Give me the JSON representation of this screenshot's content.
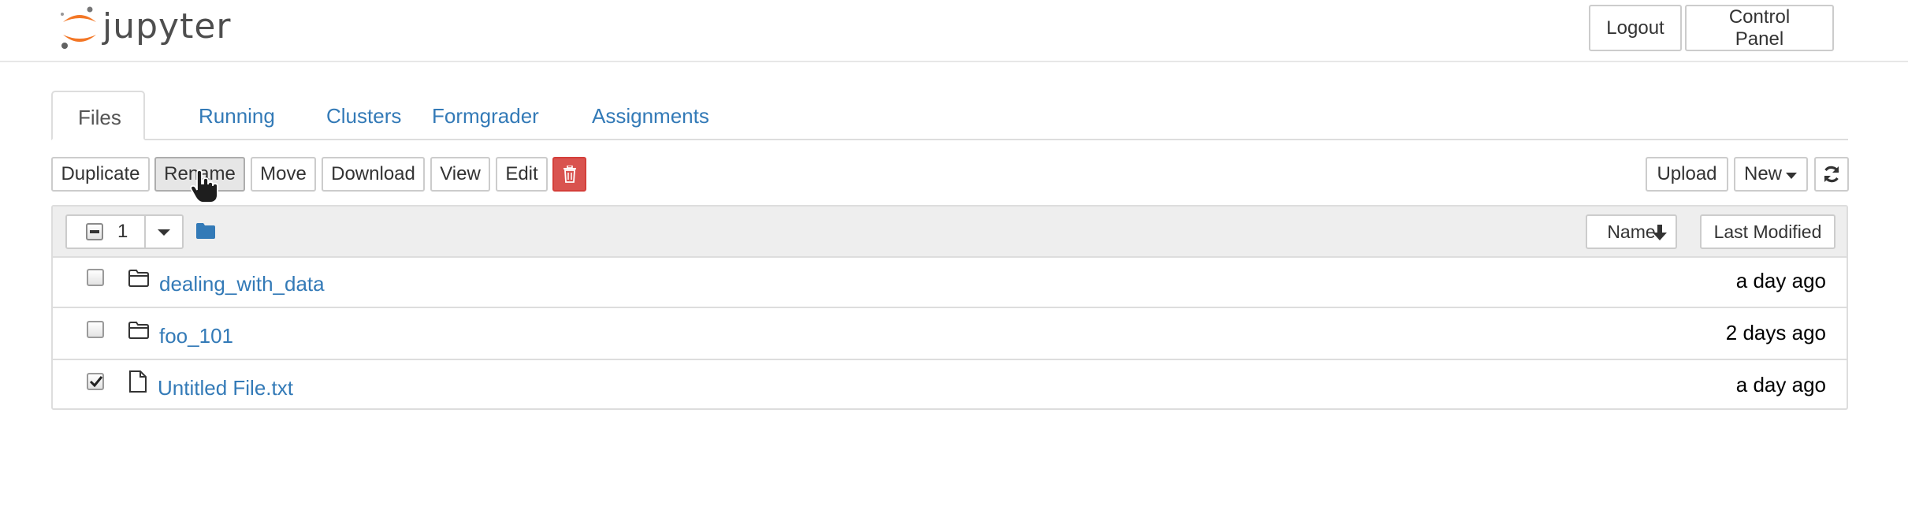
{
  "header": {
    "logo_text": "jupyter",
    "logout_label": "Logout",
    "control_panel_label": "Control Panel"
  },
  "tabs": [
    {
      "label": "Files",
      "active": true
    },
    {
      "label": "Running"
    },
    {
      "label": "Clusters"
    },
    {
      "label": "Formgrader"
    },
    {
      "label": "Assignments"
    }
  ],
  "toolbar": {
    "duplicate_label": "Duplicate",
    "rename_label": "Rename",
    "move_label": "Move",
    "download_label": "Download",
    "view_label": "View",
    "edit_label": "Edit",
    "delete_icon": "trash-icon",
    "upload_label": "Upload",
    "new_label": "New",
    "refresh_icon": "refresh-icon"
  },
  "list": {
    "selected_count": "1",
    "sort_name_label": "Name",
    "sort_modified_label": "Last Modified",
    "rows": [
      {
        "name": "dealing_with_data",
        "type": "folder",
        "modified": "a day ago",
        "checked": false
      },
      {
        "name": "foo_101",
        "type": "folder",
        "modified": "2 days ago",
        "checked": false
      },
      {
        "name": "Untitled File.txt",
        "type": "file",
        "modified": "a day ago",
        "checked": true
      }
    ]
  },
  "colors": {
    "link": "#337ab7",
    "danger": "#d9534f",
    "logo_orange": "#f37726",
    "header_bg": "#eeeeee"
  }
}
